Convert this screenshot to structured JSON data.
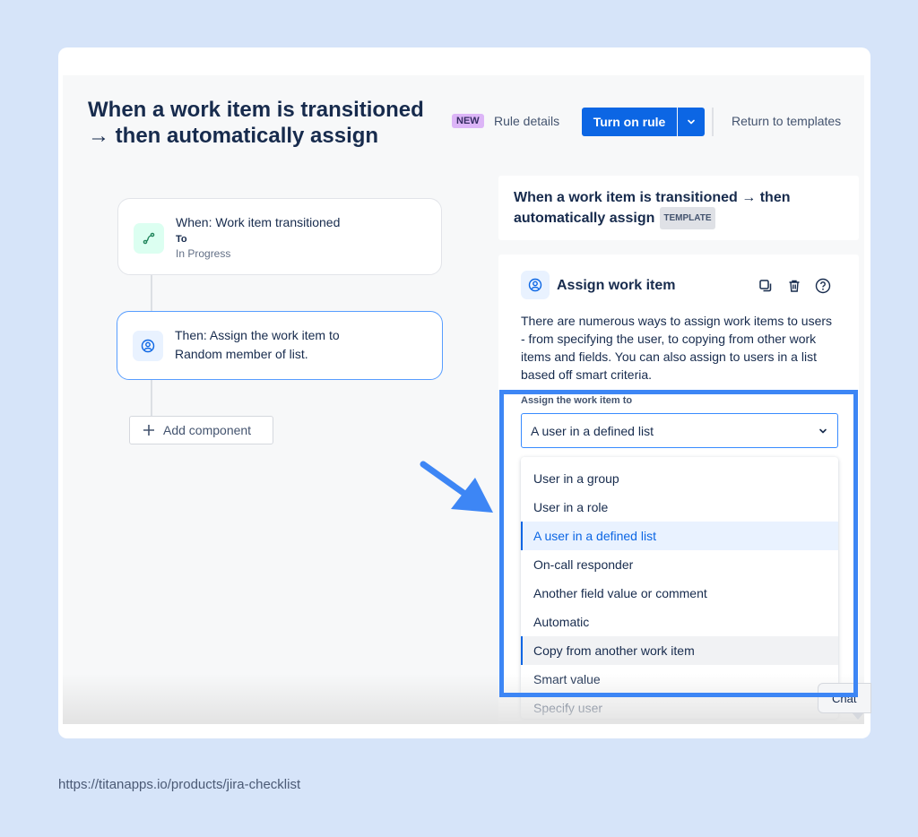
{
  "page": {
    "title_line1": "When a work item is transitioned",
    "title_line2": "→ then automatically assign"
  },
  "header": {
    "new_badge": "NEW",
    "rule_details": "Rule details",
    "turn_on_rule": "Turn on rule",
    "return_to_templates": "Return to templates"
  },
  "flow": {
    "trigger": {
      "title": "When: Work item transitioned",
      "sub_label": "To",
      "sub_value": "In Progress",
      "icon": "transition-icon"
    },
    "action": {
      "title": "Then: Assign the work item to Random member of list.",
      "icon": "user-circle-icon"
    },
    "add_component": "Add component"
  },
  "panel": {
    "title": "When a work item is transitioned → then automatically assign",
    "template_tag": "TEMPLATE",
    "component_title": "Assign work item",
    "description": "There are numerous ways to assign work items to users - from specifying the user, to copying from other work items and fields. You can also assign to users in a list based off smart criteria.",
    "field_label": "Assign the work item to",
    "selected_value": "A user in a defined list",
    "options": [
      "User in a group",
      "User in a role",
      "A user in a defined list",
      "On-call responder",
      "Another field value or comment",
      "Automatic",
      "Copy from another work item",
      "Smart value",
      "Specify user"
    ]
  },
  "chat": {
    "label": "Chat"
  },
  "footer": {
    "source_url": "https://titanapps.io/products/jira-checklist"
  },
  "colors": {
    "background": "#d6e4f9",
    "primary_button": "#0c66e4",
    "highlight_box": "#3d86f5",
    "new_badge": "#dcb5f7",
    "selected_option": "#e9f2ff"
  }
}
